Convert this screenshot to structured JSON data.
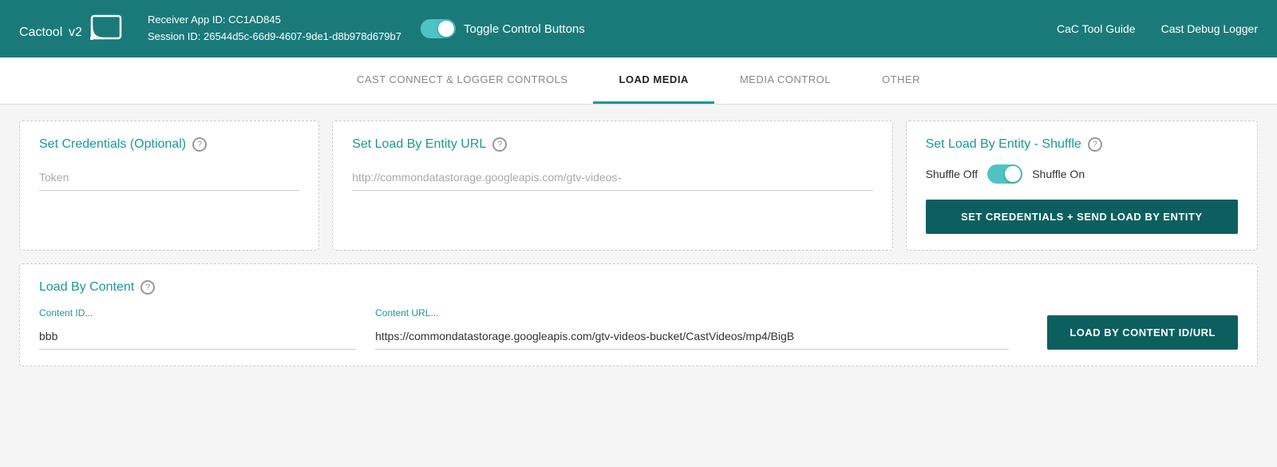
{
  "header": {
    "logo_text": "Cactool",
    "logo_version": "v2",
    "receiver_app_label": "Receiver App ID:",
    "receiver_app_id": "CC1AD845",
    "session_label": "Session ID:",
    "session_id": "26544d5c-66d9-4607-9de1-d8b978d679b7",
    "toggle_label": "Toggle Control Buttons",
    "nav_link_guide": "CaC Tool Guide",
    "nav_link_logger": "Cast Debug Logger"
  },
  "tabs": [
    {
      "id": "cast-connect",
      "label": "CAST CONNECT & LOGGER CONTROLS",
      "active": false
    },
    {
      "id": "load-media",
      "label": "LOAD MEDIA",
      "active": true
    },
    {
      "id": "media-control",
      "label": "MEDIA CONTROL",
      "active": false
    },
    {
      "id": "other",
      "label": "OTHER",
      "active": false
    }
  ],
  "load_media": {
    "credentials": {
      "title": "Set Credentials (Optional)",
      "token_placeholder": "Token"
    },
    "entity_url": {
      "title": "Set Load By Entity URL",
      "url_placeholder": "http://commondatastorage.googleapis.com/gtv-videos-"
    },
    "shuffle": {
      "title": "Set Load By Entity - Shuffle",
      "shuffle_off_label": "Shuffle Off",
      "shuffle_on_label": "Shuffle On",
      "button_label": "SET CREDENTIALS + SEND LOAD BY ENTITY"
    },
    "load_content": {
      "title": "Load By Content",
      "content_id_label": "Content ID...",
      "content_id_value": "bbb",
      "content_url_label": "Content URL...",
      "content_url_value": "https://commondatastorage.googleapis.com/gtv-videos-bucket/CastVideos/mp4/BigB",
      "button_label": "LOAD BY CONTENT ID/URL"
    }
  },
  "icons": {
    "help": "?",
    "cast": "📡"
  },
  "colors": {
    "teal": "#1a7a7a",
    "teal_light": "#1a9999",
    "dark_teal": "#0d5f5f",
    "toggle_on": "#4fc3c3"
  }
}
